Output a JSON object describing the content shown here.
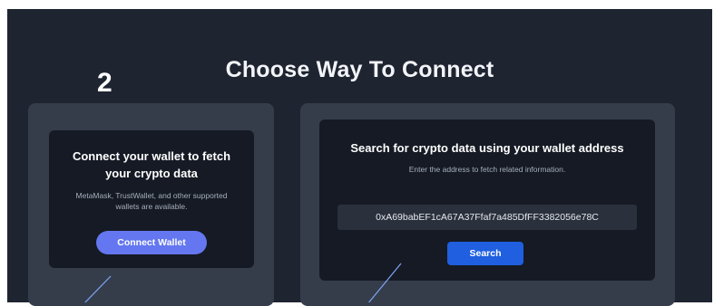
{
  "page": {
    "step_number": "2",
    "title": "Choose Way To Connect"
  },
  "wallet_option": {
    "heading": "Connect your wallet to fetch your crypto data",
    "description": "MetaMask, TrustWallet, and other supported wallets are available.",
    "button_label": "Connect Wallet"
  },
  "address_option": {
    "heading": "Search for crypto data using your wallet address",
    "description": "Enter the address to fetch related information.",
    "address_value": "0xA69babEF1cA67A37Ffaf7a485DfFF3382056e78C",
    "button_label": "Search"
  },
  "colors": {
    "background": "#1e2430",
    "outer_card": "#353d4b",
    "inner_card": "#151a24",
    "connect_button": "#6477f0",
    "search_button": "#1f5fe0"
  }
}
